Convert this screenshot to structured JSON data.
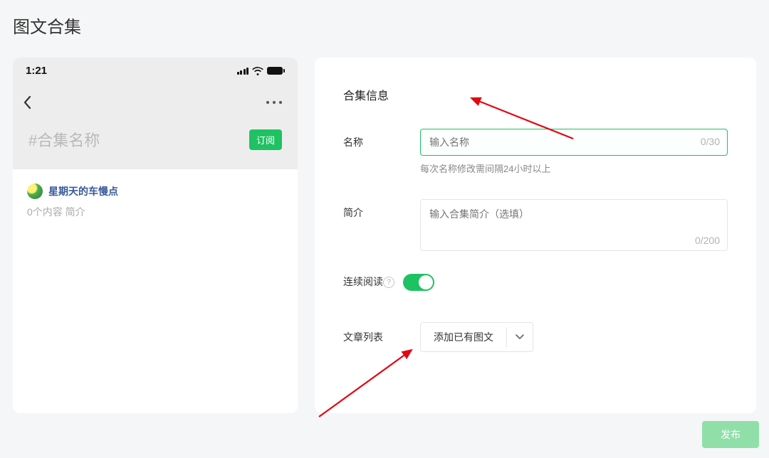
{
  "page_title": "图文合集",
  "phone": {
    "time": "1:21",
    "collection_tag": "#合集名称",
    "subscribe_label": "订阅",
    "author_name": "星期天的车慢点",
    "meta": "0个内容  简介"
  },
  "form": {
    "section_title": "合集信息",
    "name_label": "名称",
    "name_placeholder": "输入名称",
    "name_count": "0/30",
    "name_hint": "每次名称修改需间隔24小时以上",
    "desc_label": "简介",
    "desc_placeholder": "输入合集简介（选填）",
    "desc_count": "0/200",
    "read_label": "连续阅读",
    "list_label": "文章列表",
    "add_existing": "添加已有图文"
  },
  "publish_label": "发布"
}
